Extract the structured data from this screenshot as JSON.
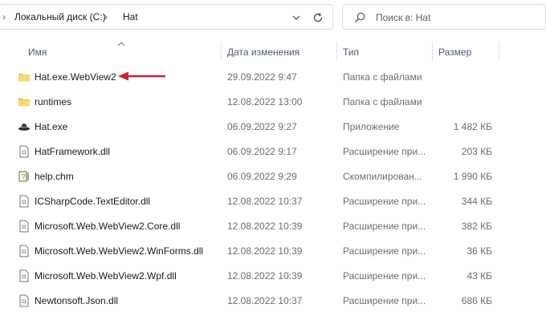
{
  "address_bar": {
    "breadcrumbs": [
      "Локальный диск (C:)",
      "Hat"
    ],
    "dropdown_icon": "chevron-down-icon",
    "refresh_icon": "refresh-icon"
  },
  "search": {
    "placeholder": "Поиск в: Hat",
    "icon": "search-icon"
  },
  "columns": {
    "name": "Имя",
    "date": "Дата изменения",
    "type": "Тип",
    "size": "Размер",
    "sorted_by": "name"
  },
  "files": [
    {
      "name": "Hat.exe.WebView2",
      "date": "29.09.2022 9:47",
      "type": "Папка с файлами",
      "size": "",
      "icon": "folder-icon"
    },
    {
      "name": "runtimes",
      "date": "12.08.2022 13:00",
      "type": "Папка с файлами",
      "size": "",
      "icon": "folder-icon"
    },
    {
      "name": "Hat.exe",
      "date": "06.09.2022 9:27",
      "type": "Приложение",
      "size": "1 482 КБ",
      "icon": "hat-app-icon"
    },
    {
      "name": "HatFramework.dll",
      "date": "06.09.2022 9:17",
      "type": "Расширение при...",
      "size": "203 КБ",
      "icon": "dll-file-icon"
    },
    {
      "name": "help.chm",
      "date": "06.09.2022 9:29",
      "type": "Скомпилирован...",
      "size": "1 990 КБ",
      "icon": "help-file-icon"
    },
    {
      "name": "ICSharpCode.TextEditor.dll",
      "date": "12.08.2022 10:37",
      "type": "Расширение при...",
      "size": "344 КБ",
      "icon": "dll-file-icon"
    },
    {
      "name": "Microsoft.Web.WebView2.Core.dll",
      "date": "12.08.2022 10:39",
      "type": "Расширение при...",
      "size": "382 КБ",
      "icon": "dll-file-icon"
    },
    {
      "name": "Microsoft.Web.WebView2.WinForms.dll",
      "date": "12.08.2022 10:39",
      "type": "Расширение при...",
      "size": "36 КБ",
      "icon": "dll-file-icon"
    },
    {
      "name": "Microsoft.Web.WebView2.Wpf.dll",
      "date": "12.08.2022 10:39",
      "type": "Расширение при...",
      "size": "43 КБ",
      "icon": "dll-file-icon"
    },
    {
      "name": "Newtonsoft.Json.dll",
      "date": "12.08.2022 10:37",
      "type": "Расширение при...",
      "size": "686 КБ",
      "icon": "dll-file-icon"
    }
  ],
  "annotation": {
    "arrow_color": "#d0202a",
    "points_to": "Hat.exe.WebView2"
  },
  "colors": {
    "header_text": "#4a5a78",
    "muted_text": "#6d6d6d",
    "folder": "#f2c94c"
  }
}
